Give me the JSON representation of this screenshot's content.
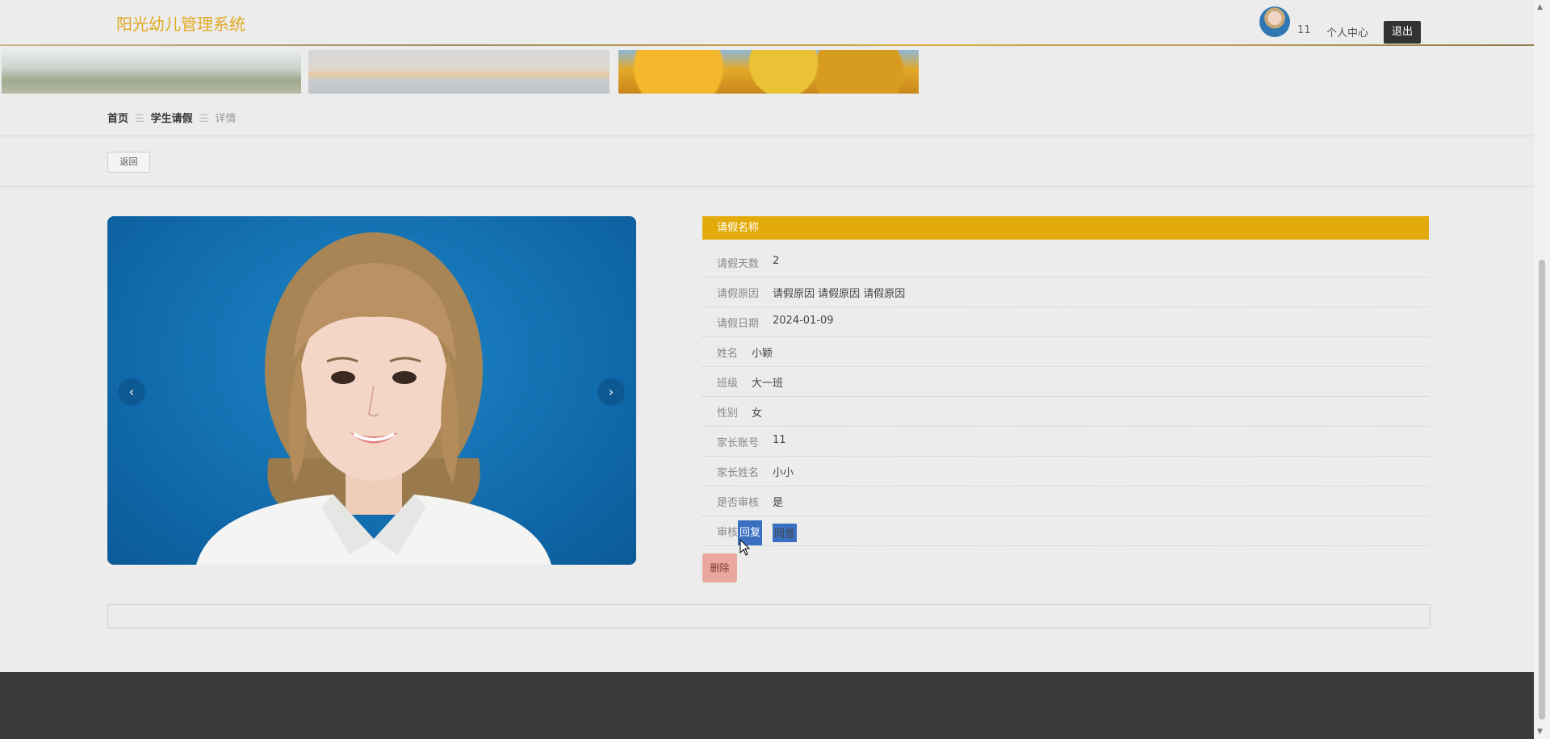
{
  "header": {
    "site_title": "阳光幼儿管理系统",
    "user_name": "11",
    "profile_label": "个人中心",
    "logout_label": "退出"
  },
  "breadcrumb": {
    "home": "首页",
    "section": "学生请假",
    "current": "详情",
    "separator": "☰"
  },
  "actions": {
    "back_label": "返回",
    "delete_label": "删除"
  },
  "carousel": {
    "prev_icon": "‹",
    "next_icon": "›"
  },
  "detail": {
    "title": "请假名称",
    "rows": [
      {
        "label": "请假天数",
        "value": "2"
      },
      {
        "label": "请假原因",
        "value": "请假原因 请假原因 请假原因"
      },
      {
        "label": "请假日期",
        "value": "2024-01-09"
      },
      {
        "label": "姓名",
        "value": "小颖"
      },
      {
        "label": "班级",
        "value": "大一班"
      },
      {
        "label": "性别",
        "value": "女"
      },
      {
        "label": "家长账号",
        "value": "11"
      },
      {
        "label": "家长姓名",
        "value": "小小"
      },
      {
        "label": "是否审核",
        "value": "是"
      }
    ],
    "review_reply": {
      "label_part1": "审核",
      "label_part2": "回复",
      "value": "同意"
    }
  },
  "colors": {
    "accent": "#e2ab0b",
    "title": "#e2a91f",
    "selection": "#3b6fc2",
    "delete": "#e9a79d",
    "footer": "#3b3b3b"
  }
}
